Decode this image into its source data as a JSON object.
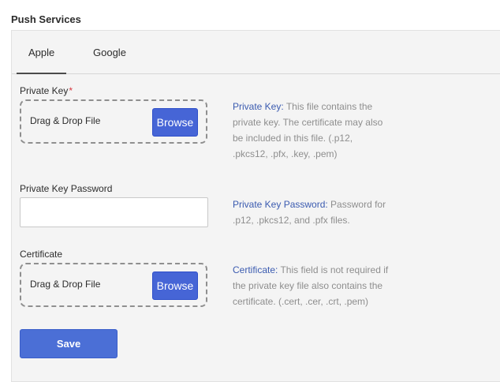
{
  "page": {
    "title": "Push Services"
  },
  "tabs": [
    {
      "label": "Apple",
      "active": true
    },
    {
      "label": "Google",
      "active": false
    }
  ],
  "private_key": {
    "label": "Private Key",
    "required_mark": "*",
    "dropzone_text": "Drag & Drop File",
    "browse_label": "Browse",
    "help_term": "Private Key:",
    "help_text": " This file contains the private key. The certificate may also be included in this file. (.p12, .pkcs12, .pfx, .key, .pem)"
  },
  "private_key_password": {
    "label": "Private Key Password",
    "value": "",
    "placeholder": "",
    "help_term": "Private Key Password:",
    "help_text": " Password for .p12, .pkcs12, and .pfx files."
  },
  "certificate": {
    "label": "Certificate",
    "dropzone_text": "Drag & Drop File",
    "browse_label": "Browse",
    "help_term": "Certificate:",
    "help_text": " This field is not required if the private key file also contains the certificate. (.cert, .cer, .crt, .pem)"
  },
  "actions": {
    "save_label": "Save"
  },
  "colors": {
    "accent": "#4665d6",
    "help_term": "#3b5bb0",
    "required": "#d7373f",
    "panel_bg": "#f4f4f4"
  }
}
